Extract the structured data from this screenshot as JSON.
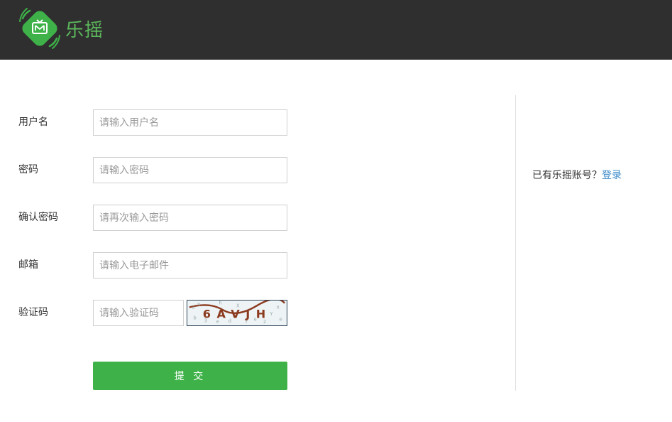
{
  "brand": {
    "name": "乐摇",
    "accent": "#5cb85c"
  },
  "form": {
    "username": {
      "label": "用户名",
      "placeholder": "请输入用户名",
      "value": ""
    },
    "password": {
      "label": "密码",
      "placeholder": "请输入密码",
      "value": ""
    },
    "confirm_password": {
      "label": "确认密码",
      "placeholder": "请再次输入密码",
      "value": ""
    },
    "email": {
      "label": "邮箱",
      "placeholder": "请输入电子邮件",
      "value": ""
    },
    "captcha": {
      "label": "验证码",
      "placeholder": "请输入验证码",
      "value": "",
      "image_text": "6AVJH"
    },
    "submit_label": "提 交",
    "submit_color": "#3eb249"
  },
  "side": {
    "question": "已有乐摇账号？",
    "login_link": "登录",
    "link_color": "#3a8ac8"
  }
}
